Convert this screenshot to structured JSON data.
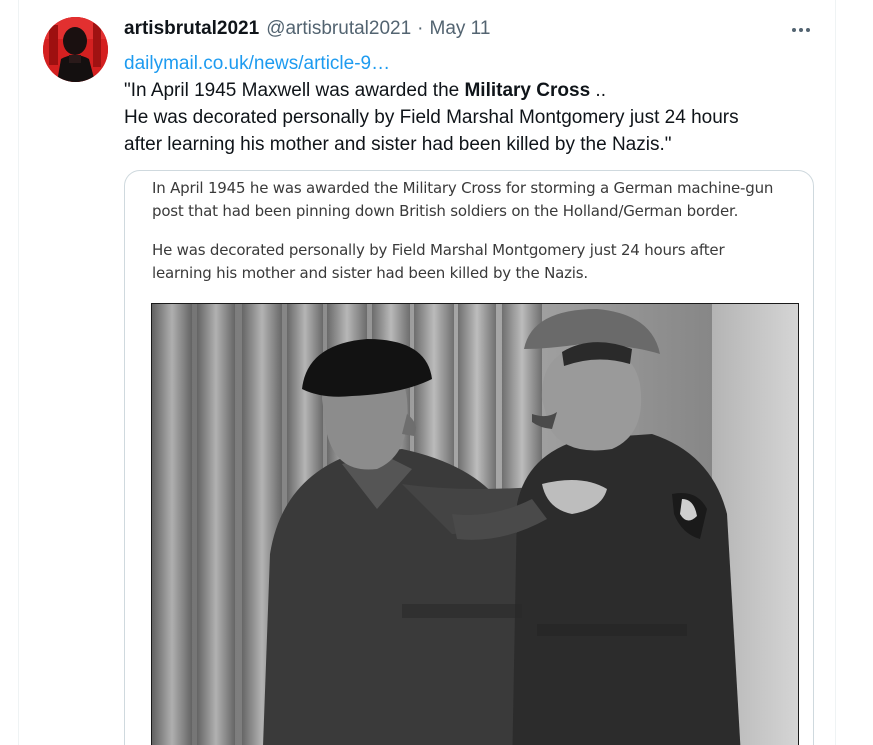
{
  "tweet": {
    "author": {
      "display_name": "artisbrutal2021",
      "handle": "@artisbrutal2021"
    },
    "separator": "·",
    "date": "May 11",
    "more_icon": "more-horizontal-icon",
    "link_text": "dailymail.co.uk/news/article-9…",
    "text": {
      "line1_before": "\"In April 1945 Maxwell was awarded the ",
      "line1_bold": "Military Cross",
      "line1_after": " ..",
      "line2": "He was decorated personally by Field Marshal Montgomery just 24 hours",
      "line3": "after learning his mother and sister had been killed by the Nazis.\""
    },
    "card": {
      "para1_line1": "In April 1945 he was awarded the Military Cross for storming a German machine-gun",
      "para1_line2": "post that had been pinning down British soldiers on the Holland/German border.",
      "para2_line1": "He was decorated personally by Field Marshal Montgomery just 24 hours after",
      "para2_line2": "learning his mother and sister had been killed by the Nazis."
    }
  },
  "colors": {
    "link": "#1d9bf0",
    "text": "#0f1419",
    "secondary": "#536471",
    "border": "#cfd9de",
    "avatar_bg": "#d31a1a"
  }
}
